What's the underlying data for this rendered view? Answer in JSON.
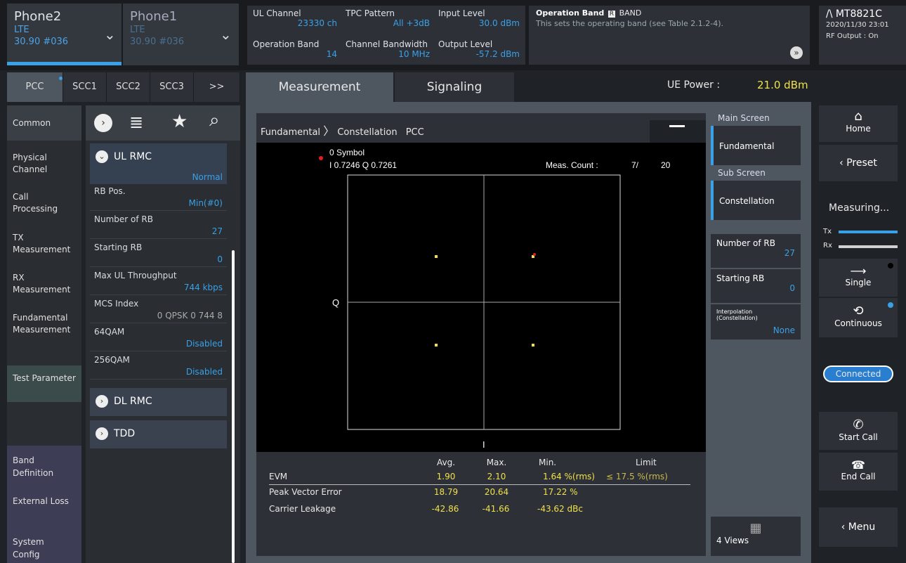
{
  "phones": [
    {
      "name": "Phone2",
      "tech": "LTE",
      "info": "30.90 #036",
      "active": true
    },
    {
      "name": "Phone1",
      "tech": "LTE",
      "info": "30.90 #036",
      "active": false
    }
  ],
  "params": {
    "ul_channel": {
      "label": "UL Channel",
      "value": "23330 ch"
    },
    "tpc": {
      "label": "TPC Pattern",
      "value": "All +3dB"
    },
    "input_level": {
      "label": "Input Level",
      "value": "30.0 dBm"
    },
    "op_band": {
      "label": "Operation Band",
      "value": "14"
    },
    "bandwidth": {
      "label": "Channel Bandwidth",
      "value": "10 MHz"
    },
    "output_level": {
      "label": "Output Level",
      "value": "-57.2 dBm"
    }
  },
  "info": {
    "title": "Operation Band",
    "badge": "R",
    "title2": "BAND",
    "desc": "This sets the operating band (see Table 2.1.2-4)."
  },
  "brand": {
    "name": "MT8821C",
    "date": "2020/11/30 23:01",
    "rf": "RF Output : On"
  },
  "carrier_tabs": [
    "PCC",
    "SCC1",
    "SCC2",
    "SCC3",
    ">>"
  ],
  "left_menu": [
    "Common",
    "Physical Channel",
    "Call Processing",
    "TX Measurement",
    "RX Measurement",
    "Fundamental Measurement",
    "Test Parameter",
    "Band Definition",
    "External Loss",
    "System Config"
  ],
  "ul_rmc": {
    "title": "UL RMC",
    "mode": "Normal",
    "rows": [
      {
        "label": "RB Pos.",
        "value": "Min(#0)"
      },
      {
        "label": "Number of RB",
        "value": "27"
      },
      {
        "label": "Starting RB",
        "value": "0"
      },
      {
        "label": "Max UL Throughput",
        "value": "744 kbps"
      },
      {
        "label": "MCS Index",
        "value": "0  QPSK  0  744  8"
      },
      {
        "label": "64QAM",
        "value": "Disabled"
      },
      {
        "label": "256QAM",
        "value": "Disabled"
      }
    ]
  },
  "dl_rmc": {
    "title": "DL RMC"
  },
  "tdd": {
    "title": "TDD"
  },
  "main_tabs": [
    "Measurement",
    "Signaling"
  ],
  "ue_power": {
    "label": "UE Power :",
    "value": "21.0 dBm"
  },
  "breadcrumb": [
    "Fundamental",
    "Constellation",
    "PCC"
  ],
  "constellation": {
    "symbol": "0 Symbol",
    "iq": "I 0.7246 Q 0.7261",
    "meas_count_label": "Meas. Count :",
    "meas_count": "7/",
    "meas_total": "20",
    "xlabel": "I",
    "ylabel": "Q"
  },
  "results": {
    "headers": [
      "Avg.",
      "Max.",
      "Min.",
      "Limit"
    ],
    "rows": [
      {
        "label": "EVM",
        "avg": "1.90",
        "max": "2.10",
        "min": "1.64 %(rms)",
        "limit": "≤ 17.5 %(rms)"
      },
      {
        "label": "Peak Vector Error",
        "avg": "18.79",
        "max": "20.64",
        "min": "17.22 %",
        "limit": ""
      },
      {
        "label": "Carrier Leakage",
        "avg": "-42.86",
        "max": "-41.66",
        "min": "-43.62 dBc",
        "limit": ""
      }
    ]
  },
  "side": {
    "main_screen": "Main Screen",
    "fundamental": "Fundamental",
    "sub_screen": "Sub Screen",
    "constellation": "Constellation",
    "num_rb_label": "Number of RB",
    "num_rb": "27",
    "start_rb_label": "Starting RB",
    "start_rb": "0",
    "interp_label": "Interpolation (Constellation)",
    "interp": "None",
    "views": "4 Views"
  },
  "right": {
    "home": "Home",
    "preset": "Preset",
    "measuring": "Measuring...",
    "tx": "Tx",
    "rx": "Rx",
    "single": "Single",
    "continuous": "Continuous",
    "connected": "Connected",
    "start_call": "Start Call",
    "end_call": "End Call",
    "menu": "Menu"
  }
}
